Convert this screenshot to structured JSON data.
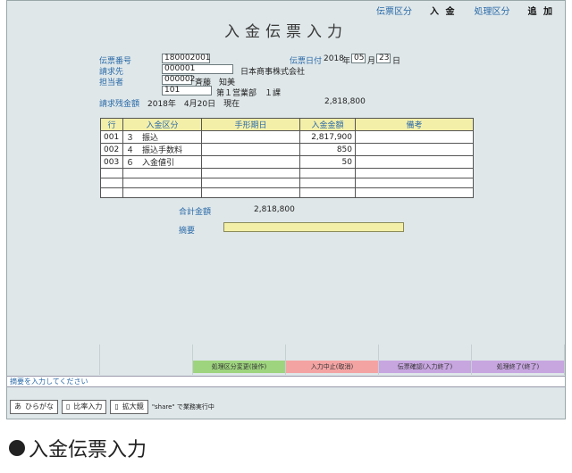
{
  "topbar": {
    "slip_type_caption": "伝票区分",
    "slip_type_value": "入 金",
    "process_type_caption": "処理区分",
    "process_type_value": "追 加"
  },
  "title": "入金伝票入力",
  "form": {
    "slip_no_label": "伝票番号",
    "slip_no": "180002001",
    "slip_date_label": "伝票日付",
    "slip_date_year": "2018",
    "year_unit": "年",
    "slip_date_month": "05",
    "month_unit": "月",
    "slip_date_day": "23",
    "day_unit": "日",
    "billing_label": "請求先",
    "billing_code": "000001",
    "billing_name": "日本商事株式会社",
    "person_label": "担当者",
    "person_code": "000002",
    "person_name": "斉藤　知美",
    "dept_code": "101",
    "dept_name": "第１営業部　１課",
    "balance_label": "請求残金額",
    "balance_date": "2018年　4月20日　現在",
    "balance_amount": "2,818,800"
  },
  "grid": {
    "headers": [
      "行",
      "入金区分",
      "手形期日",
      "入金金額",
      "備考"
    ],
    "rows": [
      {
        "line": "001",
        "type": "３　振込",
        "due": "",
        "amount": "2,817,900",
        "note": ""
      },
      {
        "line": "002",
        "type": "４　振込手数料",
        "due": "",
        "amount": "850",
        "note": ""
      },
      {
        "line": "003",
        "type": "６　入金値引",
        "due": "",
        "amount": "50",
        "note": ""
      },
      {
        "line": "",
        "type": "",
        "due": "",
        "amount": "",
        "note": ""
      },
      {
        "line": "",
        "type": "",
        "due": "",
        "amount": "",
        "note": ""
      },
      {
        "line": "",
        "type": "",
        "due": "",
        "amount": "",
        "note": ""
      }
    ]
  },
  "totals": {
    "label": "合計金額",
    "value": "2,818,800"
  },
  "memo": {
    "label": "摘要"
  },
  "fnkeys": [
    {
      "label": "",
      "color": ""
    },
    {
      "label": "",
      "color": ""
    },
    {
      "label": "処理区分変更(操作)",
      "color": "#9ed47e"
    },
    {
      "label": "入力中止(取消)",
      "color": "#f4a3a3"
    },
    {
      "label": "伝票確認(入力終了)",
      "color": "#c7a6e0"
    },
    {
      "label": "処理終了(終了)",
      "color": "#c7a6e0"
    }
  ],
  "message": "摘要を入力してください",
  "ime": {
    "mode_char": "あ",
    "mode_label": "ひらがな",
    "btn1": "比率入力",
    "btn2": "拡大鏡",
    "status": "\"share\" で業務実行中"
  },
  "caption": "入金伝票入力"
}
